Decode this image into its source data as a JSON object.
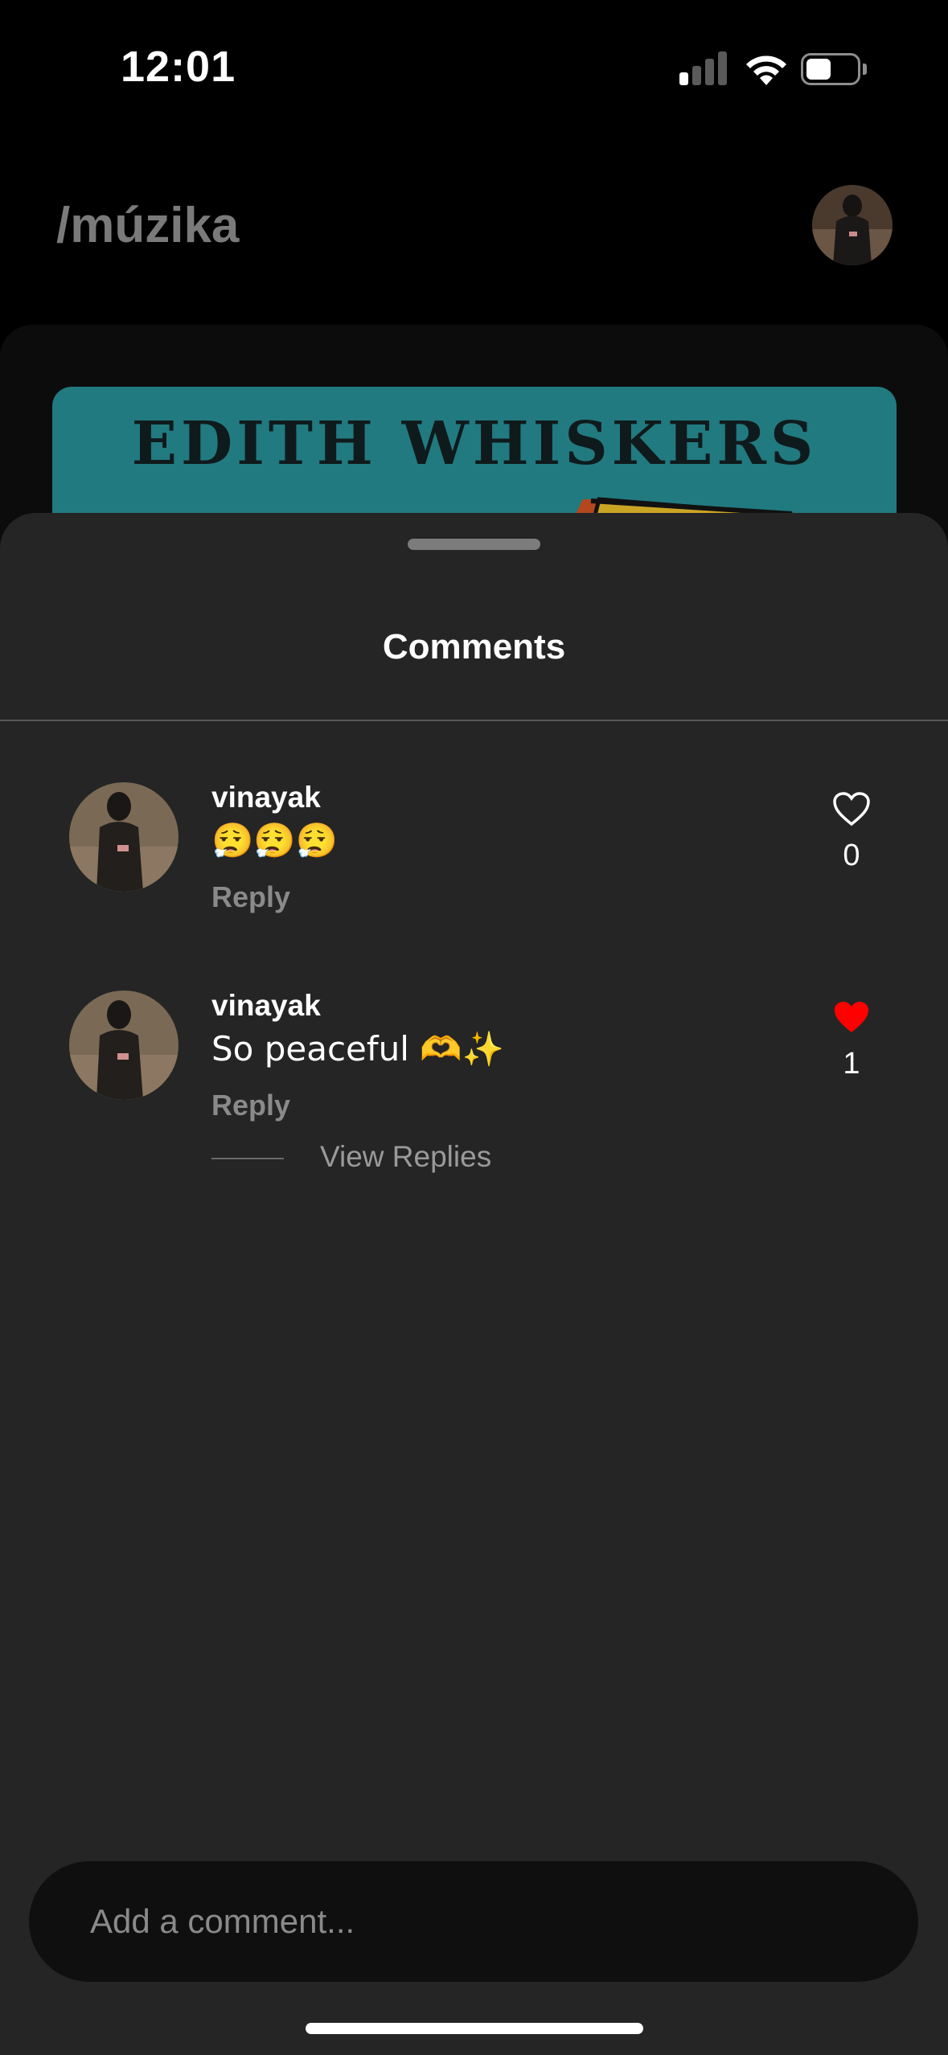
{
  "status_bar": {
    "time": "12:01",
    "icons": [
      "cellular-signal-icon",
      "wifi-icon",
      "battery-icon"
    ]
  },
  "header": {
    "title": "/múzika",
    "avatar": "profile-avatar"
  },
  "album_art": {
    "title": "EDITH WHISKERS",
    "background_color": "#217a80"
  },
  "sheet": {
    "title": "Comments"
  },
  "comments": [
    {
      "username": "vinayak",
      "text": "😮‍💨😮‍💨😮‍💨",
      "reply_label": "Reply",
      "likes": "0",
      "liked": false
    },
    {
      "username": "vinayak",
      "text": "So peaceful 🫶✨",
      "reply_label": "Reply",
      "likes": "1",
      "liked": true,
      "view_replies_label": "View Replies"
    }
  ],
  "input": {
    "placeholder": "Add a comment..."
  },
  "colors": {
    "background": "#000000",
    "sheet": "#252525",
    "liked_heart": "#ff0000",
    "muted_text": "#8a8a8a"
  }
}
